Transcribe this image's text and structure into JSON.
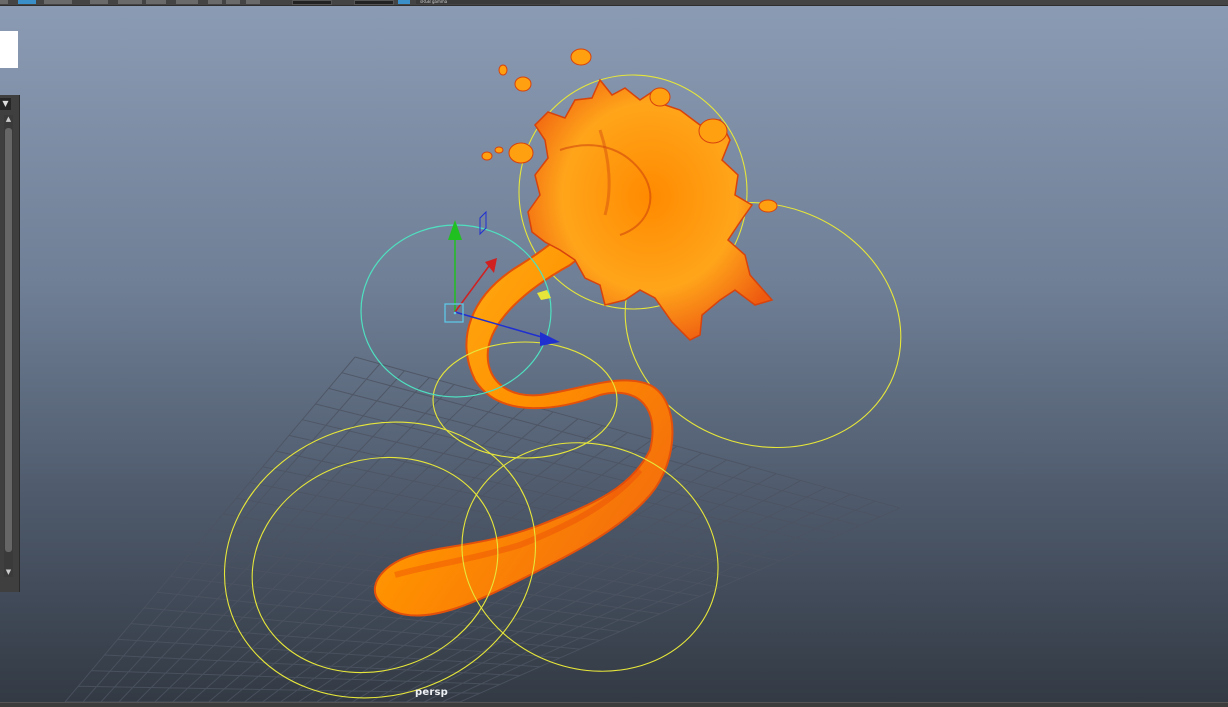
{
  "viewport": {
    "camera_label": "persp",
    "background_top": "#8a9bb3",
    "background_bottom": "#333a44"
  },
  "toolbar": {
    "icons": [
      "select-tool-icon",
      "lasso-tool-icon",
      "paint-tool-icon",
      "snap-grid-icon",
      "snap-curve-icon",
      "snap-point-icon",
      "history-icon",
      "render-icon",
      "ipr-render-icon",
      "render-settings-icon",
      "camera-icon"
    ],
    "camera_field": "sRGB gamma"
  },
  "scene_objects": {
    "mesh": "orange-noodle-splat-mesh",
    "controls": [
      "ik-control-ring",
      "curve-control-ring",
      "transform-manipulator"
    ],
    "colors": {
      "mesh": "#ff9a00",
      "mesh_shadow": "#e83c0a",
      "control_curve": "#e8e83a",
      "selected_control": "#4fe0c0",
      "axis_x": "#d02020",
      "axis_y": "#20c020",
      "axis_z": "#2030d0"
    }
  },
  "side_panel": {
    "dropdown_icon": "triangle-down-icon"
  }
}
